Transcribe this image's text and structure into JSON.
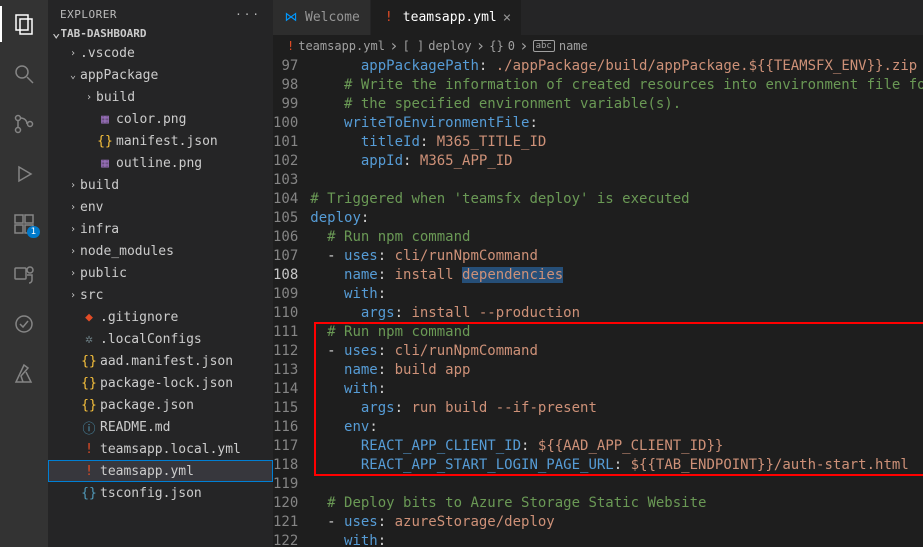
{
  "activityBar": {
    "badge": "1"
  },
  "sidebar": {
    "title": "EXPLORER",
    "section": "TAB-DASHBOARD",
    "items": [
      {
        "label": ".vscode",
        "icon": "›",
        "iconClass": "ic-folder",
        "indent": 18,
        "twisty": true
      },
      {
        "label": "appPackage",
        "icon": "⌄",
        "iconClass": "ic-folder",
        "indent": 18,
        "twisty": true
      },
      {
        "label": "build",
        "icon": "›",
        "iconClass": "ic-folder",
        "indent": 34,
        "twisty": true
      },
      {
        "label": "color.png",
        "icon": "▦",
        "iconClass": "ic-img",
        "indent": 48,
        "twisty": false
      },
      {
        "label": "manifest.json",
        "icon": "{}",
        "iconClass": "ic-json",
        "indent": 48,
        "twisty": false
      },
      {
        "label": "outline.png",
        "icon": "▦",
        "iconClass": "ic-img",
        "indent": 48,
        "twisty": false
      },
      {
        "label": "build",
        "icon": "›",
        "iconClass": "ic-folder",
        "indent": 18,
        "twisty": true
      },
      {
        "label": "env",
        "icon": "›",
        "iconClass": "ic-folder",
        "indent": 18,
        "twisty": true
      },
      {
        "label": "infra",
        "icon": "›",
        "iconClass": "ic-folder",
        "indent": 18,
        "twisty": true
      },
      {
        "label": "node_modules",
        "icon": "›",
        "iconClass": "ic-folder",
        "indent": 18,
        "twisty": true
      },
      {
        "label": "public",
        "icon": "›",
        "iconClass": "ic-folder",
        "indent": 18,
        "twisty": true
      },
      {
        "label": "src",
        "icon": "›",
        "iconClass": "ic-folder",
        "indent": 18,
        "twisty": true
      },
      {
        "label": ".gitignore",
        "icon": "◆",
        "iconClass": "ic-git",
        "indent": 32,
        "twisty": false
      },
      {
        "label": ".localConfigs",
        "icon": "✲",
        "iconClass": "ic-conf",
        "indent": 32,
        "twisty": false
      },
      {
        "label": "aad.manifest.json",
        "icon": "{}",
        "iconClass": "ic-json",
        "indent": 32,
        "twisty": false
      },
      {
        "label": "package-lock.json",
        "icon": "{}",
        "iconClass": "ic-json",
        "indent": 32,
        "twisty": false
      },
      {
        "label": "package.json",
        "icon": "{}",
        "iconClass": "ic-json",
        "indent": 32,
        "twisty": false
      },
      {
        "label": "README.md",
        "icon": "ⓘ",
        "iconClass": "ic-md",
        "indent": 32,
        "twisty": false
      },
      {
        "label": "teamsapp.local.yml",
        "icon": "!",
        "iconClass": "ic-yml",
        "indent": 32,
        "twisty": false
      },
      {
        "label": "teamsapp.yml",
        "icon": "!",
        "iconClass": "ic-yml",
        "indent": 32,
        "twisty": false,
        "selected": true
      },
      {
        "label": "tsconfig.json",
        "icon": "{}",
        "iconClass": "ic-ts",
        "indent": 32,
        "twisty": false
      }
    ]
  },
  "tabs": {
    "welcome": {
      "label": "Welcome"
    },
    "active": {
      "label": "teamsapp.yml"
    }
  },
  "breadcrumb": {
    "file": "teamsapp.yml",
    "p1": "deploy",
    "p2": "0",
    "p3": "name"
  },
  "code": {
    "startLine": 97,
    "lines": [
      "      <key>appPackagePath</key><punc>: </punc><str>./appPackage/build/appPackage.${{TEAMSFX_ENV}}.zip</str>",
      "    <cmt># Write the information of created resources into environment file for</cmt>",
      "    <cmt># the specified environment variable(s).</cmt>",
      "    <key>writeToEnvironmentFile</key><punc>:</punc>",
      "      <key>titleId</key><punc>: </punc><str>M365_TITLE_ID</str>",
      "      <key>appId</key><punc>: </punc><str>M365_APP_ID</str>",
      "",
      "<cmt># Triggered when 'teamsfx deploy' is executed</cmt>",
      "<key>deploy</key><punc>:</punc>",
      "  <cmt># Run npm command</cmt>",
      "  <punc>- </punc><key>uses</key><punc>: </punc><str>cli/runNpmCommand</str>",
      "    <key>name</key><punc>: </punc><str>install </str><sel>dependencies</sel>",
      "    <key>with</key><punc>:</punc>",
      "      <key>args</key><punc>: </punc><str>install --production</str>",
      "  <cmt># Run npm command</cmt>",
      "  <punc>- </punc><key>uses</key><punc>: </punc><str>cli/runNpmCommand</str>",
      "    <key>name</key><punc>: </punc><str>build app</str>",
      "    <key>with</key><punc>:</punc>",
      "      <key>args</key><punc>: </punc><str>run build --if-present</str>",
      "    <key>env</key><punc>:</punc>",
      "      <key>REACT_APP_CLIENT_ID</key><punc>: </punc><str>${{AAD_APP_CLIENT_ID}}</str>",
      "      <key>REACT_APP_START_LOGIN_PAGE_URL</key><punc>: </punc><str>${{TAB_ENDPOINT}}/auth-start.html</str>",
      "",
      "  <cmt># Deploy bits to Azure Storage Static Website</cmt>",
      "  <punc>- </punc><key>uses</key><punc>: </punc><str>azureStorage/deploy</str>",
      "    <key>with</key><punc>:</punc>"
    ],
    "currentLine": 108,
    "highlightBox": {
      "startLine": 111,
      "endLine": 118
    }
  }
}
